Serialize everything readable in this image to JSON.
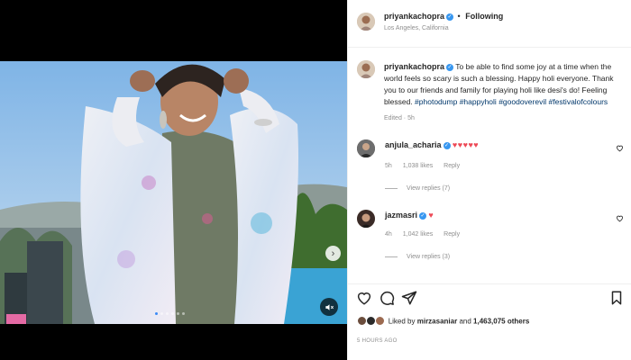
{
  "header": {
    "username": "priyankachopra",
    "follow_label": "Following",
    "separator": "•",
    "location": "Los Angeles, California"
  },
  "caption": {
    "username": "priyankachopra",
    "text": "To be able to find some joy at a time when the world feels so scary is such a blessing. Happy holi everyone. Thank you to our friends and family for playing holi like desi's do! Feeling blessed.",
    "hashtags": [
      "#photodump",
      "#happyholi",
      "#goodoverevil",
      "#festivalofcolours"
    ],
    "edited": "Edited · 5h"
  },
  "comments": [
    {
      "username": "anjula_acharia",
      "text": "♥♥♥♥♥",
      "time": "5h",
      "likes": "1,038 likes",
      "reply_label": "Reply",
      "view_replies": "View replies (7)"
    },
    {
      "username": "jazmasri",
      "text": "♥",
      "time": "4h",
      "likes": "1,042 likes",
      "reply_label": "Reply",
      "view_replies": "View replies (3)"
    }
  ],
  "likes": {
    "prefix": "Liked by",
    "user": "mirzasaniar",
    "connector": "and",
    "count": "1,463,075 others"
  },
  "time_ago": "5 HOURS AGO",
  "carousel": {
    "dots": 6,
    "active_index": 0
  },
  "icons": {
    "like": "heart-icon",
    "comment": "comment-icon",
    "share": "share-icon",
    "save": "bookmark-icon",
    "next": "chevron-right-icon",
    "mute": "muted-speaker-icon",
    "verified": "verified-badge-icon",
    "comment_like": "heart-icon"
  },
  "colors": {
    "accent": "#3897f0",
    "hashtag": "#00376b",
    "heart_red": "#ed4956",
    "muted_text": "#8e8e8e"
  }
}
